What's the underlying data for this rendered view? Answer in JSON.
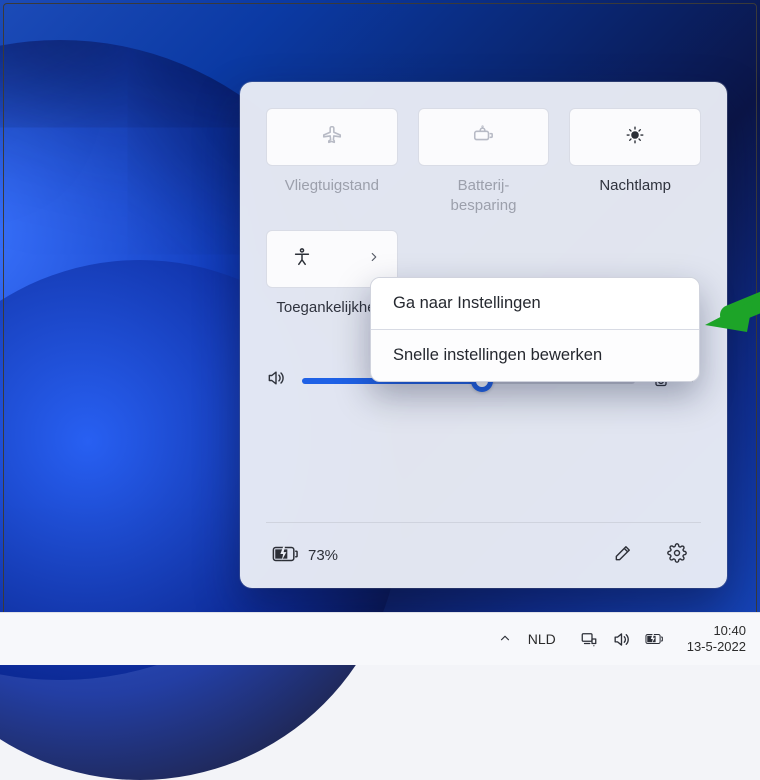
{
  "tiles": [
    {
      "name": "airplane-mode",
      "label": "Vliegtuigstand",
      "muted": true,
      "icon": "airplane",
      "split": false
    },
    {
      "name": "battery-saver",
      "label": "Batterij-\nbesparing",
      "muted": true,
      "icon": "battery-saver",
      "split": false
    },
    {
      "name": "night-light",
      "label": "Nachtlamp",
      "muted": false,
      "icon": "night-light",
      "split": false
    },
    {
      "name": "accessibility",
      "label": "Toegankelijkheid",
      "muted": false,
      "icon": "accessibility",
      "split": true
    },
    {
      "name": "cast",
      "label": "",
      "muted": false,
      "icon": "cast",
      "split": true
    },
    {
      "name": "nearby-share",
      "label": "",
      "muted": false,
      "icon": "share",
      "split": false
    }
  ],
  "volume_percent": 54,
  "battery": {
    "percent_text": "73%"
  },
  "context_menu": {
    "items": [
      "Ga naar Instellingen",
      "Snelle instellingen bewerken"
    ]
  },
  "taskbar": {
    "ime": "NLD",
    "time": "10:40",
    "date": "13-5-2022"
  }
}
